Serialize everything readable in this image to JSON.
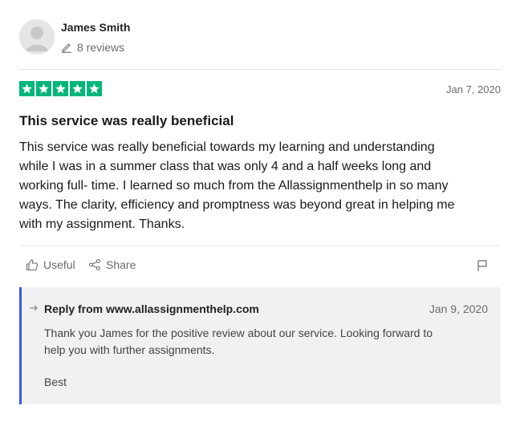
{
  "author": {
    "name": "James Smith",
    "reviews": "8 reviews"
  },
  "rating": {
    "stars": 5,
    "color": "#00b67a"
  },
  "review": {
    "date": "Jan 7, 2020",
    "title": "This service was really beneficial",
    "lines": [
      "This service was really beneficial towards my learning and understanding",
      "while I was in a summer class that was only 4 and a half weeks long and",
      "working full- time. I learned so much from the Allassignmenthelp in so many",
      "ways. The clarity, efficiency and promptness was beyond great in helping me",
      "with my assignment. Thanks."
    ]
  },
  "actions": {
    "useful": "Useful",
    "share": "Share"
  },
  "reply": {
    "from": "Reply from www.allassignmenthelp.com",
    "date": "Jan 9, 2020",
    "lines": [
      "Thank you James for the positive review about our service. Looking forward to",
      "help you with further assignments."
    ],
    "sign": "Best",
    "accent": "#3c57e4"
  }
}
